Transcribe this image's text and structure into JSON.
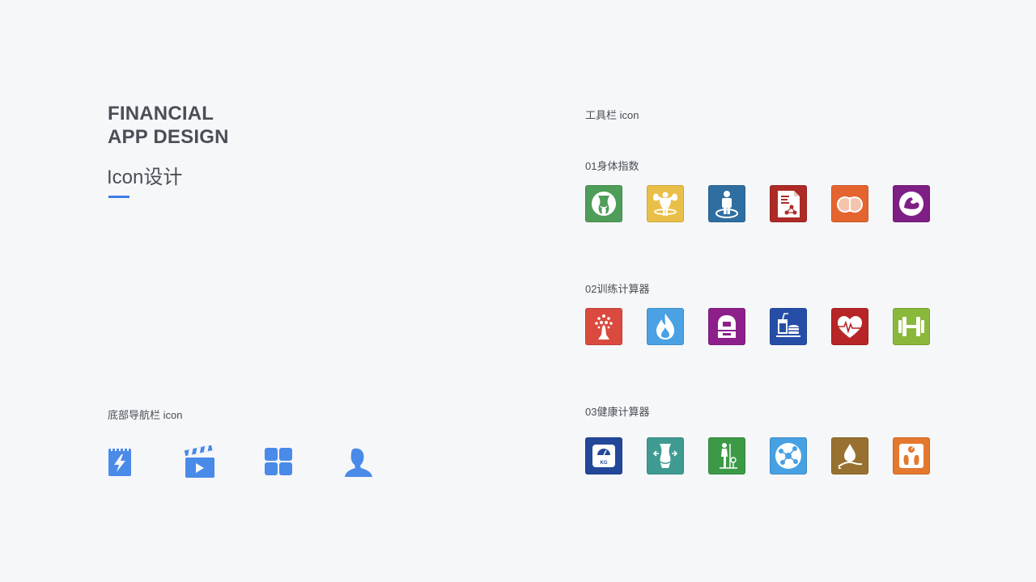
{
  "header": {
    "title_line1": "FINANCIAL",
    "title_line2": "APP DESIGN",
    "subtitle": "Icon设计",
    "accent": "#3f7ee8"
  },
  "bottom_nav": {
    "label": "底部导航栏 icon",
    "icons": [
      "notepad-lightning-icon",
      "clapperboard-play-icon",
      "four-squares-grid-icon",
      "user-bust-icon"
    ],
    "color": "#4a8ae8"
  },
  "toolbar": {
    "label": "工具栏 icon",
    "sections": [
      {
        "label": "01身体指数",
        "icons": [
          {
            "name": "waist-body-icon",
            "color": "#4e9d58"
          },
          {
            "name": "muscle-man-icon",
            "color": "#e9bf48"
          },
          {
            "name": "person-standing-icon",
            "color": "#2f6ea0"
          },
          {
            "name": "report-chart-icon",
            "color": "#ae2a26"
          },
          {
            "name": "hips-icon",
            "color": "#e4642f"
          },
          {
            "name": "bicep-flex-icon",
            "color": "#7e1f85"
          }
        ]
      },
      {
        "label": "02训练计算器",
        "icons": [
          {
            "name": "tree-icon",
            "color": "#da4a3e"
          },
          {
            "name": "flame-icon",
            "color": "#4aa1e3"
          },
          {
            "name": "machine-icon",
            "color": "#8d1f8b"
          },
          {
            "name": "food-drink-icon",
            "color": "#264ea6"
          },
          {
            "name": "heart-rate-icon",
            "color": "#b72527"
          },
          {
            "name": "dumbbell-icon",
            "color": "#89b83b"
          }
        ]
      },
      {
        "label": "03健康计算器",
        "icons": [
          {
            "name": "weight-scale-kg-icon",
            "color": "#23489a"
          },
          {
            "name": "waist-measure-icon",
            "color": "#3f9b92"
          },
          {
            "name": "height-measure-icon",
            "color": "#3c9a47"
          },
          {
            "name": "molecule-icon",
            "color": "#47a0e2"
          },
          {
            "name": "water-drop-icon",
            "color": "#987131"
          },
          {
            "name": "bathroom-scale-icon",
            "color": "#e4782e"
          }
        ]
      }
    ]
  }
}
